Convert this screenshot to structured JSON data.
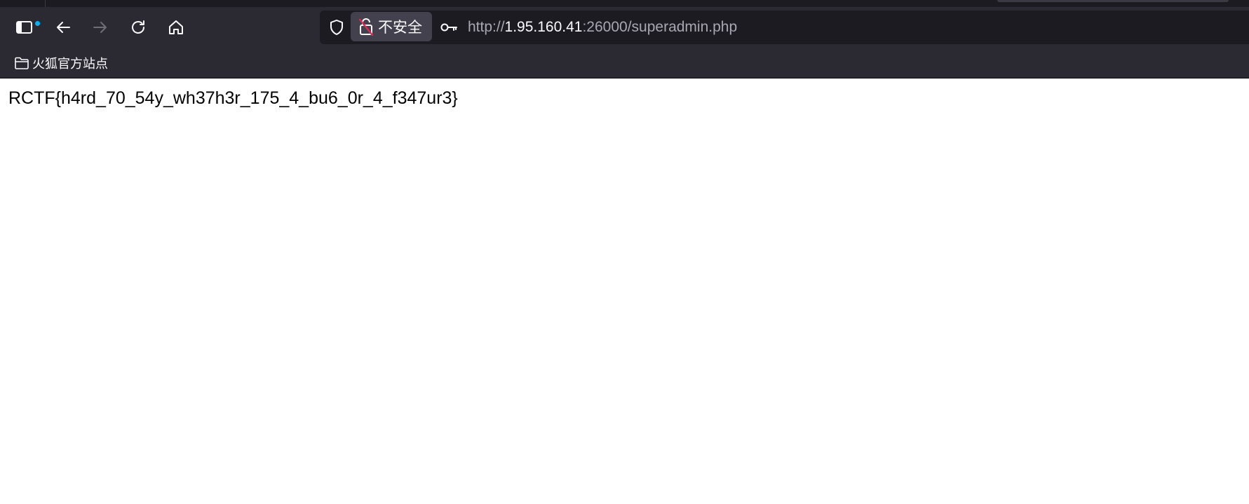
{
  "browser": {
    "security": {
      "label": "不安全",
      "warning_color": "#e22850"
    },
    "url": {
      "scheme": "http://",
      "host": "1.95.160.41",
      "rest": ":26000/superadmin.php"
    },
    "icons": {
      "sidebar": "sidebar-icon",
      "back": "back-arrow-icon",
      "forward": "forward-arrow-icon",
      "reload": "reload-icon",
      "home": "home-icon",
      "shield": "shield-icon",
      "lock": "insecure-lock-icon",
      "key": "key-icon",
      "folder": "folder-icon"
    },
    "sidebar_badge_color": "#00b3f4"
  },
  "bookmarks": {
    "items": [
      {
        "label": "火狐官方站点"
      }
    ]
  },
  "page": {
    "text": "RCTF{h4rd_70_54y_wh37h3r_175_4_bu6_0r_4_f347ur3}"
  }
}
